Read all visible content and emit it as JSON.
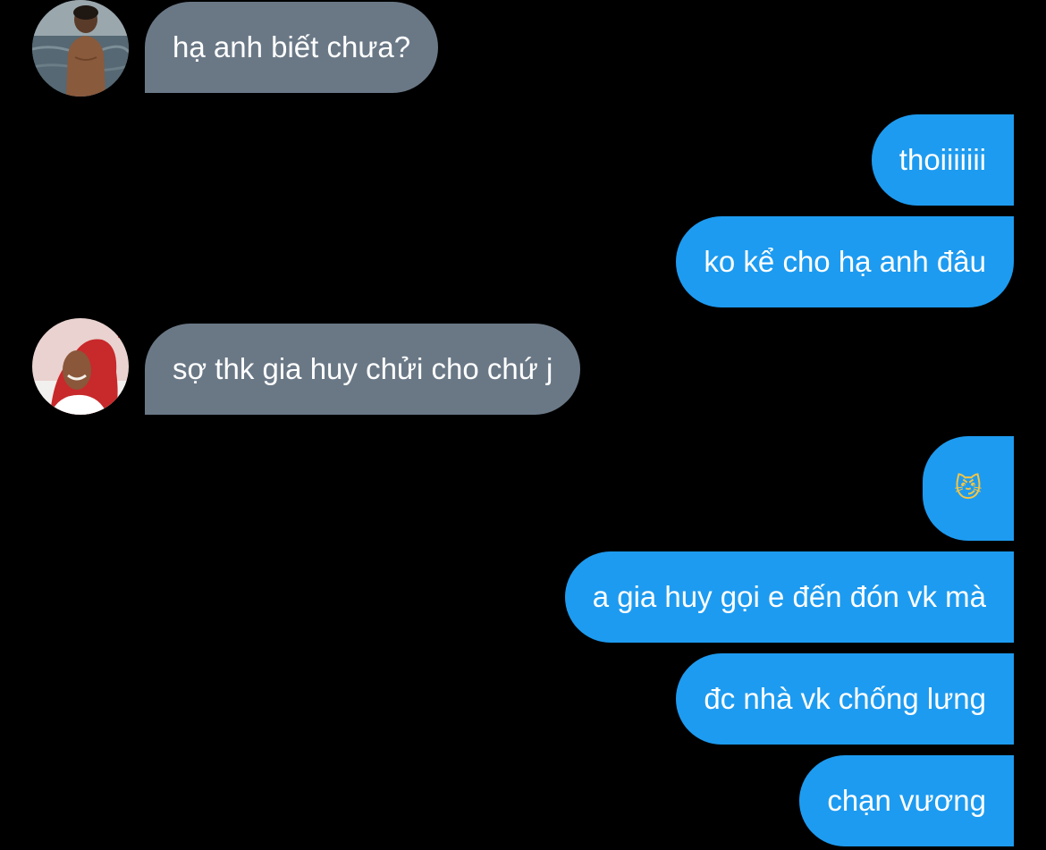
{
  "messages": [
    {
      "sender": "other",
      "text": "hạ anh biết chưa?"
    },
    {
      "sender": "me",
      "text": "thoiiiiiii"
    },
    {
      "sender": "me",
      "text": "ko kể cho hạ anh đâu"
    },
    {
      "sender": "other",
      "text": "sợ thk gia huy chửi cho chứ j"
    },
    {
      "sender": "me",
      "text": "😼"
    },
    {
      "sender": "me",
      "text": "a gia huy gọi e đến đón vk mà"
    },
    {
      "sender": "me",
      "text": "đc nhà vk chống lưng"
    },
    {
      "sender": "me",
      "text": "chạn vương"
    }
  ],
  "colors": {
    "background": "#000000",
    "incoming_bubble": "#6a7886",
    "outgoing_bubble": "#1d9bf0",
    "text": "#ffffff"
  },
  "avatars": [
    "shirtless-man-at-sea-avatar",
    "person-red-headscarf-avatar"
  ]
}
